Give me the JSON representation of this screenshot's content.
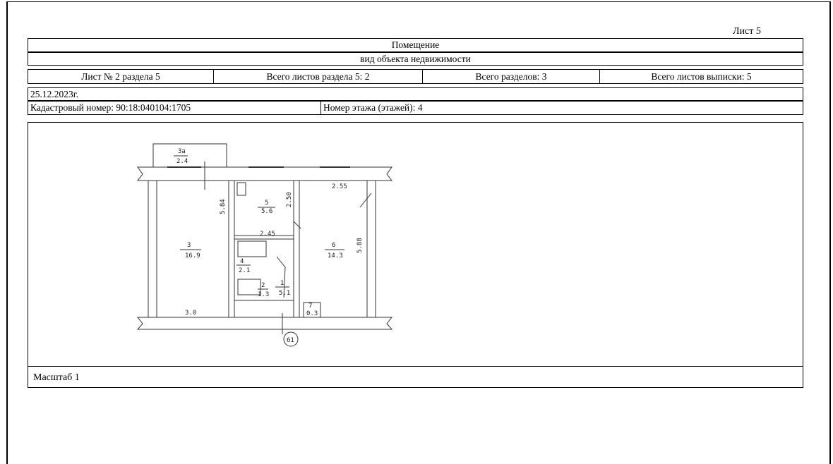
{
  "header": {
    "sheet_label": "Лист 5",
    "title": "Помещение",
    "subtitle": "вид объекта недвижимости"
  },
  "sheet_info": {
    "sheet_of_section": "Лист № 2 раздела 5",
    "total_sheets_section": "Всего листов раздела 5: 2",
    "total_sections": "Всего разделов: 3",
    "total_sheets_extract": "Всего листов выписки: 5"
  },
  "date": "25.12.2023г.",
  "cadastral": {
    "number_label": "Кадастровый номер: 90:18:040104:1705",
    "floor_label": "Номер этажа (этажей): 4"
  },
  "plan": {
    "rooms": [
      {
        "no": "3а",
        "area": "2.4"
      },
      {
        "no": "3",
        "area": "16.9"
      },
      {
        "no": "5",
        "area": "5.6"
      },
      {
        "no": "4",
        "area": "2.1"
      },
      {
        "no": "2",
        "area": "1.3"
      },
      {
        "no": "1",
        "area": "5.1"
      },
      {
        "no": "6",
        "area": "14.3"
      },
      {
        "no": "7",
        "area": "0.3"
      }
    ],
    "dims": [
      "2.55",
      "5.84",
      "2.45",
      "2.50",
      "5.88",
      "3.0"
    ],
    "axis_mark": "61",
    "scale_label": "Масштаб 1"
  }
}
